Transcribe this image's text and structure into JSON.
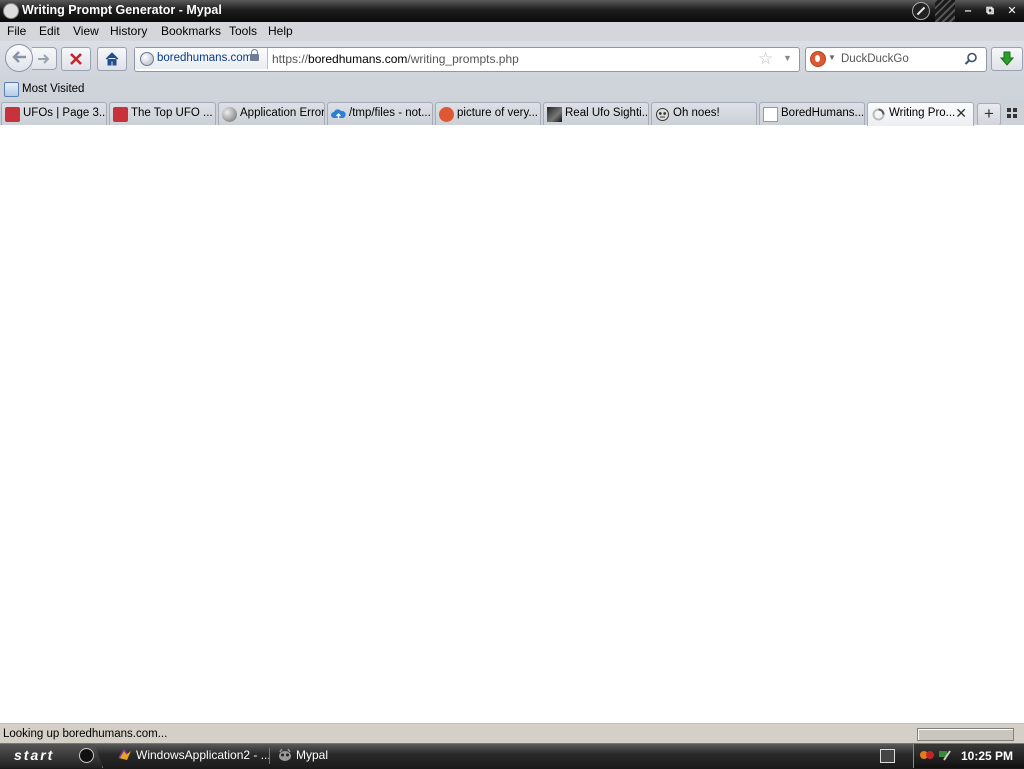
{
  "window": {
    "title": "Writing Prompt Generator - Mypal",
    "controls": {
      "minimize": "‒",
      "restore": "⧉",
      "close": "✕"
    }
  },
  "menu": {
    "items": [
      {
        "label": "File"
      },
      {
        "label": "Edit"
      },
      {
        "label": "View"
      },
      {
        "label": "History"
      },
      {
        "label": "Bookmarks"
      },
      {
        "label": "Tools"
      },
      {
        "label": "Help"
      }
    ]
  },
  "navbar": {
    "identity_host": "boredhumans.com",
    "url_scheme": "https://",
    "url_host": "boredhumans.com",
    "url_path": "/writing_prompts.php",
    "search_placeholder": "DuckDuckGo"
  },
  "bookmarks": {
    "most_visited": "Most Visited"
  },
  "tabs": [
    {
      "label": "UFOs | Page 3...",
      "icon": "red-bookmark-icon",
      "selected": false
    },
    {
      "label": "The Top UFO ...",
      "icon": "red-bookmark-icon",
      "selected": false
    },
    {
      "label": "Application Error",
      "icon": "globe-icon",
      "selected": false
    },
    {
      "label": "/tmp/files - not...",
      "icon": "cloud-upload-icon",
      "selected": false
    },
    {
      "label": "picture of very...",
      "icon": "duckduckgo-icon",
      "selected": false
    },
    {
      "label": "Real Ufo Sighti...",
      "icon": "photo-thumbnail-icon",
      "selected": false
    },
    {
      "label": "Oh noes!",
      "icon": "alien-icon",
      "selected": false
    },
    {
      "label": "BoredHumans....",
      "icon": "site-logo-icon",
      "selected": false
    },
    {
      "label": "Writing Pro...",
      "icon": "loading-spinner-icon",
      "selected": true,
      "close": "✕"
    }
  ],
  "tabstrip": {
    "new_tab": "+"
  },
  "status": {
    "text": "Looking up boredhumans.com..."
  },
  "taskbar": {
    "start_label": "start",
    "tasks": [
      {
        "label": "WindowsApplication2 - ..."
      },
      {
        "label": "Mypal"
      }
    ],
    "clock": "10:25 PM"
  },
  "colors": {
    "chrome_bg": "#cfd3da",
    "titlebar_dark": "#0a0a0a",
    "taskbar_dark": "#1a1a1a",
    "status_bg": "#d4d0c8"
  }
}
